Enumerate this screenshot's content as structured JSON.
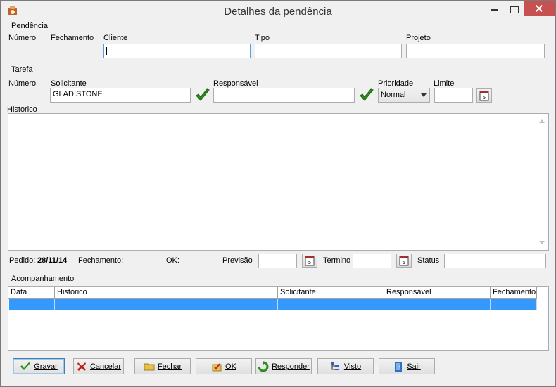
{
  "window": {
    "title": "Detalhes da pendência"
  },
  "pendencia": {
    "group_label": "Pendência",
    "numero_label": "Número",
    "fechamento_label": "Fechamento",
    "cliente_label": "Cliente",
    "cliente_value": "",
    "tipo_label": "Tipo",
    "tipo_value": "",
    "projeto_label": "Projeto",
    "projeto_value": ""
  },
  "tarefa": {
    "group_label": "Tarefa",
    "numero_label": "Número",
    "solicitante_label": "Solicitante",
    "solicitante_value": "GLADISTONE",
    "responsavel_label": "Responsável",
    "responsavel_value": "",
    "prioridade_label": "Prioridade",
    "prioridade_value": "Normal",
    "limite_label": "Limite",
    "limite_value": "",
    "historico_label": "Historico",
    "historico_value": ""
  },
  "status_line": {
    "pedido_label": "Pedido:",
    "pedido_date": "28/11/14",
    "fechamento_label": "Fechamento:",
    "ok_label": "OK:",
    "previsao_label": "Previsão",
    "previsao_value": "",
    "termino_label": "Termino",
    "termino_value": "",
    "status_label": "Status",
    "status_value": ""
  },
  "acompanhamento": {
    "group_label": "Acompanhamento",
    "columns": [
      "Data",
      "Histórico",
      "Solicitante",
      "Responsável",
      "Fechamento"
    ]
  },
  "buttons": {
    "gravar": "Gravar",
    "cancelar": "Cancelar",
    "fechar": "Fechar",
    "ok": "OK",
    "responder": "Responder",
    "visto": "Visto",
    "sair": "Sair"
  },
  "colors": {
    "selection": "#3399ff",
    "close_button": "#c75050",
    "check_green": "#2a8f1a"
  }
}
